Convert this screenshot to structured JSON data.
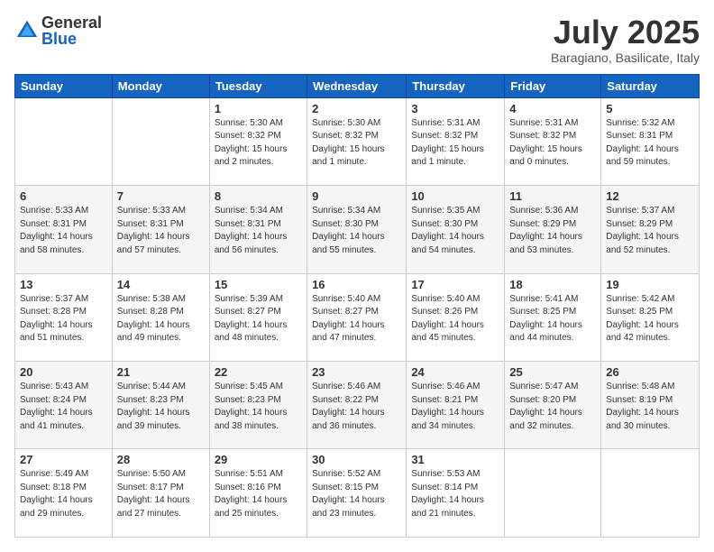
{
  "header": {
    "logo_general": "General",
    "logo_blue": "Blue",
    "month_title": "July 2025",
    "location": "Baragiano, Basilicate, Italy"
  },
  "days_of_week": [
    "Sunday",
    "Monday",
    "Tuesday",
    "Wednesday",
    "Thursday",
    "Friday",
    "Saturday"
  ],
  "weeks": [
    [
      {
        "day": "",
        "info": ""
      },
      {
        "day": "",
        "info": ""
      },
      {
        "day": "1",
        "info": "Sunrise: 5:30 AM\nSunset: 8:32 PM\nDaylight: 15 hours\nand 2 minutes."
      },
      {
        "day": "2",
        "info": "Sunrise: 5:30 AM\nSunset: 8:32 PM\nDaylight: 15 hours\nand 1 minute."
      },
      {
        "day": "3",
        "info": "Sunrise: 5:31 AM\nSunset: 8:32 PM\nDaylight: 15 hours\nand 1 minute."
      },
      {
        "day": "4",
        "info": "Sunrise: 5:31 AM\nSunset: 8:32 PM\nDaylight: 15 hours\nand 0 minutes."
      },
      {
        "day": "5",
        "info": "Sunrise: 5:32 AM\nSunset: 8:31 PM\nDaylight: 14 hours\nand 59 minutes."
      }
    ],
    [
      {
        "day": "6",
        "info": "Sunrise: 5:33 AM\nSunset: 8:31 PM\nDaylight: 14 hours\nand 58 minutes."
      },
      {
        "day": "7",
        "info": "Sunrise: 5:33 AM\nSunset: 8:31 PM\nDaylight: 14 hours\nand 57 minutes."
      },
      {
        "day": "8",
        "info": "Sunrise: 5:34 AM\nSunset: 8:31 PM\nDaylight: 14 hours\nand 56 minutes."
      },
      {
        "day": "9",
        "info": "Sunrise: 5:34 AM\nSunset: 8:30 PM\nDaylight: 14 hours\nand 55 minutes."
      },
      {
        "day": "10",
        "info": "Sunrise: 5:35 AM\nSunset: 8:30 PM\nDaylight: 14 hours\nand 54 minutes."
      },
      {
        "day": "11",
        "info": "Sunrise: 5:36 AM\nSunset: 8:29 PM\nDaylight: 14 hours\nand 53 minutes."
      },
      {
        "day": "12",
        "info": "Sunrise: 5:37 AM\nSunset: 8:29 PM\nDaylight: 14 hours\nand 52 minutes."
      }
    ],
    [
      {
        "day": "13",
        "info": "Sunrise: 5:37 AM\nSunset: 8:28 PM\nDaylight: 14 hours\nand 51 minutes."
      },
      {
        "day": "14",
        "info": "Sunrise: 5:38 AM\nSunset: 8:28 PM\nDaylight: 14 hours\nand 49 minutes."
      },
      {
        "day": "15",
        "info": "Sunrise: 5:39 AM\nSunset: 8:27 PM\nDaylight: 14 hours\nand 48 minutes."
      },
      {
        "day": "16",
        "info": "Sunrise: 5:40 AM\nSunset: 8:27 PM\nDaylight: 14 hours\nand 47 minutes."
      },
      {
        "day": "17",
        "info": "Sunrise: 5:40 AM\nSunset: 8:26 PM\nDaylight: 14 hours\nand 45 minutes."
      },
      {
        "day": "18",
        "info": "Sunrise: 5:41 AM\nSunset: 8:25 PM\nDaylight: 14 hours\nand 44 minutes."
      },
      {
        "day": "19",
        "info": "Sunrise: 5:42 AM\nSunset: 8:25 PM\nDaylight: 14 hours\nand 42 minutes."
      }
    ],
    [
      {
        "day": "20",
        "info": "Sunrise: 5:43 AM\nSunset: 8:24 PM\nDaylight: 14 hours\nand 41 minutes."
      },
      {
        "day": "21",
        "info": "Sunrise: 5:44 AM\nSunset: 8:23 PM\nDaylight: 14 hours\nand 39 minutes."
      },
      {
        "day": "22",
        "info": "Sunrise: 5:45 AM\nSunset: 8:23 PM\nDaylight: 14 hours\nand 38 minutes."
      },
      {
        "day": "23",
        "info": "Sunrise: 5:46 AM\nSunset: 8:22 PM\nDaylight: 14 hours\nand 36 minutes."
      },
      {
        "day": "24",
        "info": "Sunrise: 5:46 AM\nSunset: 8:21 PM\nDaylight: 14 hours\nand 34 minutes."
      },
      {
        "day": "25",
        "info": "Sunrise: 5:47 AM\nSunset: 8:20 PM\nDaylight: 14 hours\nand 32 minutes."
      },
      {
        "day": "26",
        "info": "Sunrise: 5:48 AM\nSunset: 8:19 PM\nDaylight: 14 hours\nand 30 minutes."
      }
    ],
    [
      {
        "day": "27",
        "info": "Sunrise: 5:49 AM\nSunset: 8:18 PM\nDaylight: 14 hours\nand 29 minutes."
      },
      {
        "day": "28",
        "info": "Sunrise: 5:50 AM\nSunset: 8:17 PM\nDaylight: 14 hours\nand 27 minutes."
      },
      {
        "day": "29",
        "info": "Sunrise: 5:51 AM\nSunset: 8:16 PM\nDaylight: 14 hours\nand 25 minutes."
      },
      {
        "day": "30",
        "info": "Sunrise: 5:52 AM\nSunset: 8:15 PM\nDaylight: 14 hours\nand 23 minutes."
      },
      {
        "day": "31",
        "info": "Sunrise: 5:53 AM\nSunset: 8:14 PM\nDaylight: 14 hours\nand 21 minutes."
      },
      {
        "day": "",
        "info": ""
      },
      {
        "day": "",
        "info": ""
      }
    ]
  ]
}
